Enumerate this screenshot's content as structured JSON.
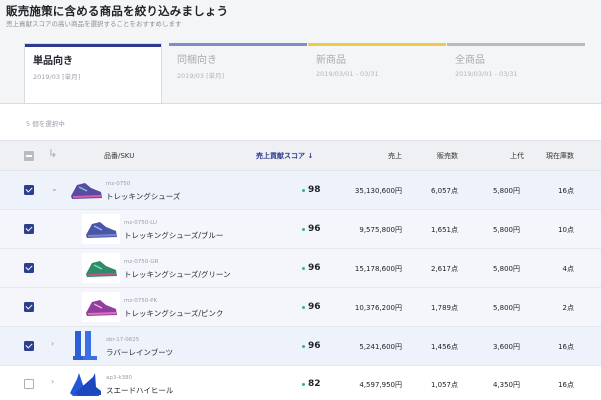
{
  "header": {
    "title": "販売施策に含める商品を絞り込みましょう",
    "subtitle": "売上貢献スコアの高い商品を選択することをおすすめします"
  },
  "tabs": [
    {
      "label": "単品向き",
      "date": "2019/03 [単月]",
      "active": true,
      "color": "#2f3a8f"
    },
    {
      "label": "同梱向き",
      "date": "2019/03 [単月]",
      "active": false,
      "color": "#7f8ec9"
    },
    {
      "label": "新商品",
      "date": "2019/03/01 - 03/31",
      "active": false,
      "color": "#f2c84b"
    },
    {
      "label": "全商品",
      "date": "2019/03/01 - 03/31",
      "active": false,
      "color": "#b7bbc2"
    }
  ],
  "selection": {
    "count_label": "5 個を選択中"
  },
  "table": {
    "columns": {
      "product": "品番/SKU",
      "score": "売上貢献スコア",
      "sales": "売上",
      "units": "販売数",
      "price": "上代",
      "stock": "現在庫数"
    },
    "sort_icon": "↓",
    "rows": [
      {
        "sku": "mz-0750",
        "name": "トレッキングシューズ",
        "score": "98",
        "sales": "35,130,600円",
        "units": "6,057点",
        "price": "5,800円",
        "stock": "16点",
        "checked": true,
        "expand": "v",
        "level": 0
      },
      {
        "sku": "mz-0750-LU",
        "name": "トレッキングシューズ/ブルー",
        "score": "96",
        "sales": "9,575,800円",
        "units": "1,651点",
        "price": "5,800円",
        "stock": "10点",
        "checked": true,
        "expand": "",
        "level": 1
      },
      {
        "sku": "mz-0750-GR",
        "name": "トレッキングシューズ/グリーン",
        "score": "96",
        "sales": "15,178,600円",
        "units": "2,617点",
        "price": "5,800円",
        "stock": "4点",
        "checked": true,
        "expand": "",
        "level": 1
      },
      {
        "sku": "mz-0750-PK",
        "name": "トレッキングシューズ/ピンク",
        "score": "96",
        "sales": "10,376,200円",
        "units": "1,789点",
        "price": "5,800円",
        "stock": "2点",
        "checked": true,
        "expand": "",
        "level": 1
      },
      {
        "sku": "sbr-17-0625",
        "name": "ラバーレインブーツ",
        "score": "96",
        "sales": "5,241,600円",
        "units": "1,456点",
        "price": "3,600円",
        "stock": "16点",
        "checked": true,
        "expand": ">",
        "level": 0
      },
      {
        "sku": "ap3-k380",
        "name": "スエードハイヒール",
        "score": "82",
        "sales": "4,597,950円",
        "units": "1,057点",
        "price": "4,350円",
        "stock": "16点",
        "checked": false,
        "expand": ">",
        "level": 0
      }
    ]
  }
}
